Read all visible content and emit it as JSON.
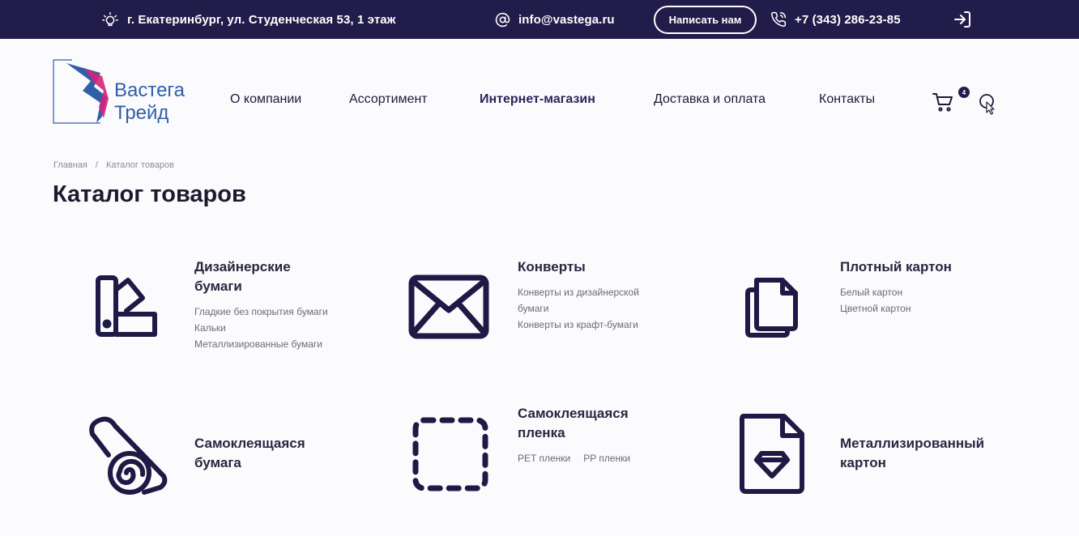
{
  "topbar": {
    "address": "г. Екатеринбург, ул. Студенческая 53, 1 этаж",
    "email": "info@vastega.ru",
    "write_label": "Написать нам",
    "phone": "+7 (343) 286-23-85"
  },
  "logo": {
    "line1": "Вастега",
    "line2": "Трейд"
  },
  "nav": {
    "about": "О компании",
    "assortment": "Ассортимент",
    "shop": "Интернет-магазин",
    "delivery": "Доставка и оплата",
    "contacts": "Контакты"
  },
  "cart": {
    "count": "4"
  },
  "breadcrumb": {
    "home": "Главная",
    "separator": "/",
    "current": "Каталог товаров"
  },
  "page_title": "Каталог товаров",
  "catalog": [
    {
      "title_l1": "Дизайнерские",
      "title_l2": "бумаги",
      "icon": "swatch-icon",
      "subs": [
        "Гладкие без покрытия бумаги",
        "Кальки",
        "Металлизированные бумаги"
      ]
    },
    {
      "title_l1": "Конверты",
      "title_l2": "",
      "icon": "envelope-icon",
      "subs": [
        "Конверты из дизайнерской",
        "бумаги",
        "Конверты из крафт-бумаги"
      ]
    },
    {
      "title_l1": "Плотный картон",
      "title_l2": "",
      "icon": "copy-icon",
      "subs": [
        "Белый картон",
        "Цветной картон"
      ]
    },
    {
      "title_l1": "Самоклеящаяся",
      "title_l2": "бумага",
      "icon": "roll-icon",
      "subs": []
    },
    {
      "title_l1": "Самоклеящаяся",
      "title_l2": "пленка",
      "icon": "dashed-square-icon",
      "subs": [
        "PET пленки",
        "PP пленки"
      ]
    },
    {
      "title_l1": "Металлизированный",
      "title_l2": "картон",
      "icon": "file-diamond-icon",
      "subs": []
    }
  ],
  "colors": {
    "topbar_bg": "#221c4a",
    "icon_color": "#1e1a45",
    "logo_blue": "#2f5fa8",
    "logo_magenta": "#d4247a"
  }
}
